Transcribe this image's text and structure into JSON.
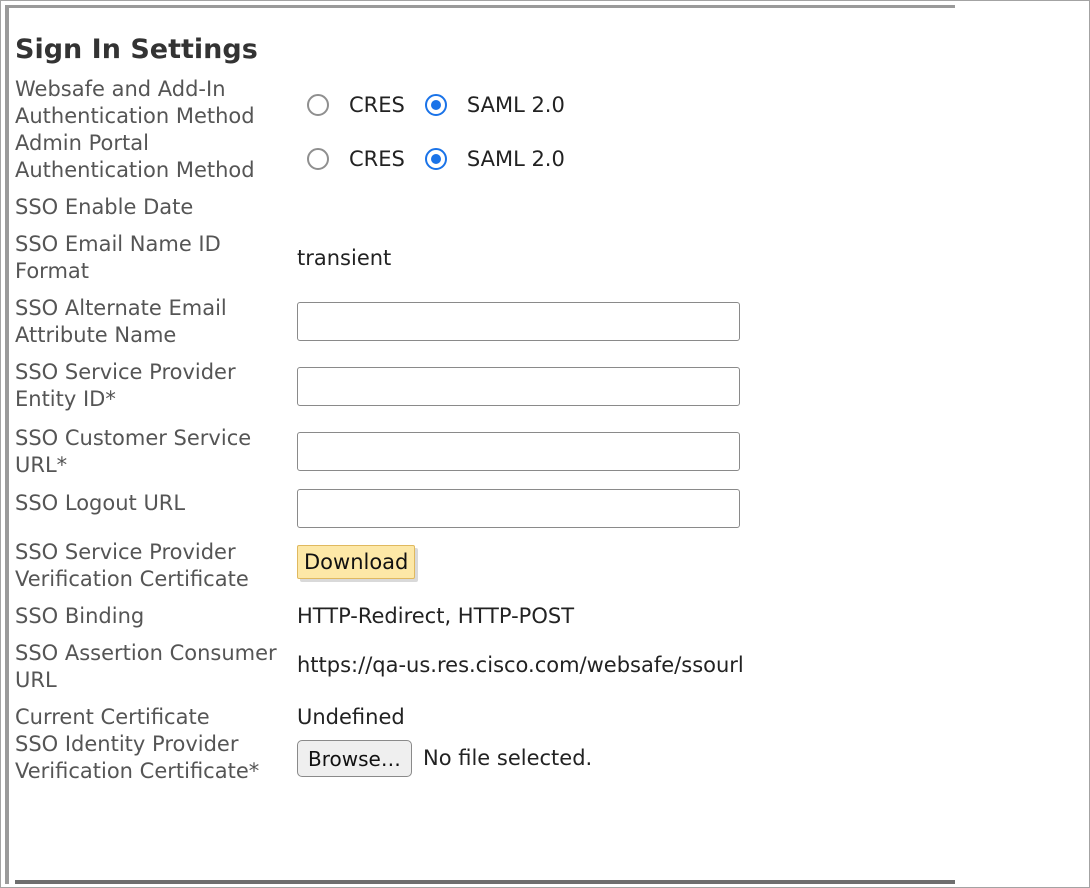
{
  "title": "Sign In Settings",
  "rows": {
    "websafe_auth": {
      "label": "Websafe and Add-In Authentication Method",
      "options": [
        {
          "label": "CRES",
          "checked": false
        },
        {
          "label": "SAML 2.0",
          "checked": true
        }
      ]
    },
    "admin_auth": {
      "label": "Admin Portal Authentication Method",
      "options": [
        {
          "label": "CRES",
          "checked": false
        },
        {
          "label": "SAML 2.0",
          "checked": true
        }
      ]
    },
    "sso_enable_date": {
      "label": "SSO Enable Date",
      "value": ""
    },
    "sso_email_name_id": {
      "label": "SSO Email Name ID Format",
      "value": "transient"
    },
    "sso_alt_email": {
      "label": "SSO Alternate Email Attribute Name",
      "value": ""
    },
    "sso_sp_entity": {
      "label": "SSO Service Provider Entity ID*",
      "value": ""
    },
    "sso_customer_url": {
      "label": "SSO Customer Service URL*",
      "value": ""
    },
    "sso_logout_url": {
      "label": "SSO Logout URL",
      "value": ""
    },
    "sso_sp_cert": {
      "label": "SSO Service Provider Verification Certificate",
      "button": "Download"
    },
    "sso_binding": {
      "label": "SSO Binding",
      "value": "HTTP-Redirect, HTTP-POST"
    },
    "sso_acs_url": {
      "label": "SSO Assertion Consumer URL",
      "value": "https://qa-us.res.cisco.com/websafe/ssourl"
    },
    "current_cert": {
      "label": "Current Certificate",
      "value": "Undefined"
    },
    "sso_idp_cert": {
      "label": "SSO Identity Provider Verification Certificate*",
      "button": "Browse…",
      "file_status": "No file selected."
    }
  },
  "colors": {
    "radio_accent": "#1a73e8",
    "download_bg": "#fde8a7"
  }
}
